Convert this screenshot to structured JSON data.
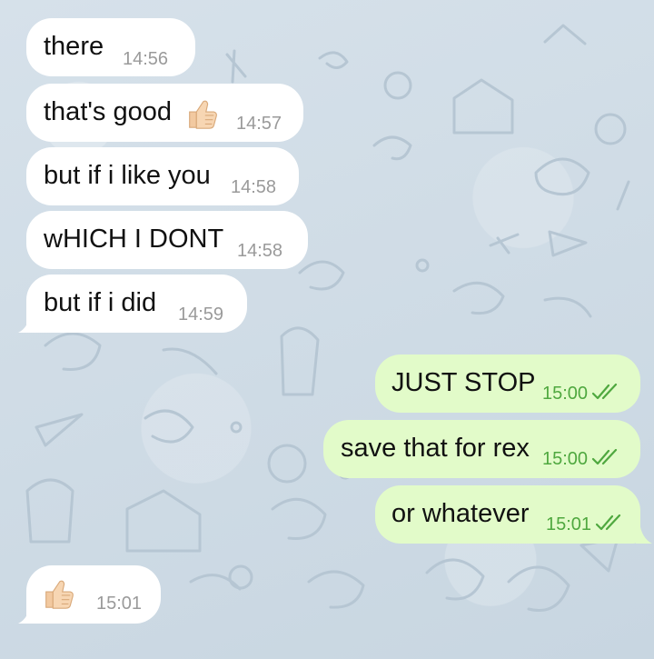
{
  "colors": {
    "incoming_bubble": "#ffffff",
    "outgoing_bubble": "#e2fbc9",
    "outgoing_time": "#4fa83f",
    "incoming_time": "#9a9a9a",
    "wallpaper": "#cfdbe5"
  },
  "messages": [
    {
      "direction": "incoming",
      "text": "there",
      "time": "14:56"
    },
    {
      "direction": "incoming",
      "text": "that's good",
      "emoji": "thumbs-up",
      "time": "14:57"
    },
    {
      "direction": "incoming",
      "text": "but if i like you",
      "time": "14:58"
    },
    {
      "direction": "incoming",
      "text": "wHICH I DONT",
      "time": "14:58"
    },
    {
      "direction": "incoming",
      "text": "but if i did",
      "time": "14:59"
    },
    {
      "direction": "outgoing",
      "text": "JUST STOP",
      "time": "15:00",
      "status": "read"
    },
    {
      "direction": "outgoing",
      "text": "save that for rex",
      "time": "15:00",
      "status": "read"
    },
    {
      "direction": "outgoing",
      "text": "or whatever",
      "time": "15:01",
      "status": "read"
    },
    {
      "direction": "incoming",
      "text": "",
      "emoji": "thumbs-up",
      "time": "15:01"
    }
  ]
}
